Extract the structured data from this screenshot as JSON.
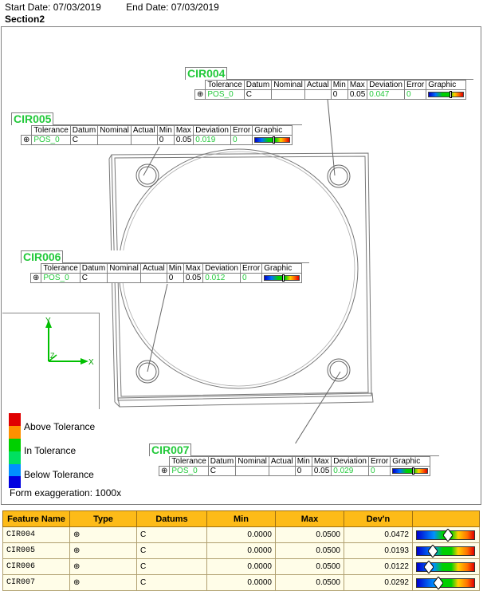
{
  "header": {
    "start_date_label": "Start Date: 07/03/2019",
    "end_date_label": "End Date: 07/03/2019",
    "section_title": "Section2"
  },
  "callout_headers": [
    "Tolerance",
    "Datum",
    "Nominal",
    "Actual",
    "Min",
    "Max",
    "Deviation",
    "Error",
    "Graphic"
  ],
  "callouts": [
    {
      "name": "CIR004",
      "tolerance": "POS_0",
      "datum": "C",
      "nominal": "",
      "actual": "",
      "min": "0",
      "max": "0.05",
      "deviation": "0.047",
      "error": "0",
      "graphic_fraction": 0.47
    },
    {
      "name": "CIR005",
      "tolerance": "POS_0",
      "datum": "C",
      "nominal": "",
      "actual": "",
      "min": "0",
      "max": "0.05",
      "deviation": "0.019",
      "error": "0",
      "graphic_fraction": 0.19
    },
    {
      "name": "CIR006",
      "tolerance": "POS_0",
      "datum": "C",
      "nominal": "",
      "actual": "",
      "min": "0",
      "max": "0.05",
      "deviation": "0.012",
      "error": "0",
      "graphic_fraction": 0.12
    },
    {
      "name": "CIR007",
      "tolerance": "POS_0",
      "datum": "C",
      "nominal": "",
      "actual": "",
      "min": "0",
      "max": "0.05",
      "deviation": "0.029",
      "error": "0",
      "graphic_fraction": 0.29
    }
  ],
  "axis_labels": {
    "y": "Y",
    "z": "Z",
    "x": "X"
  },
  "legend": {
    "above": "Above Tolerance",
    "in": "In Tolerance",
    "below": "Below Tolerance",
    "exaggeration": "Form exaggeration: 1000x"
  },
  "colors": {
    "above_1": "#e00000",
    "above_2": "#ff9000",
    "in_1": "#00d000",
    "in_2": "#00d000",
    "below_1": "#0090ff",
    "below_2": "#0000e0",
    "label_green": "#22c93a",
    "table_header": "#fdbb18"
  },
  "results_table": {
    "headers": [
      "Feature Name",
      "Type",
      "Datums",
      "Min",
      "Max",
      "Dev'n",
      ""
    ],
    "rows": [
      {
        "feature": "CIR004",
        "type_icon": "position-icon",
        "datums": "C",
        "min": "0.0000",
        "max": "0.0500",
        "dev": "0.0472",
        "dev_fraction": 0.472
      },
      {
        "feature": "CIR005",
        "type_icon": "position-icon",
        "datums": "C",
        "min": "0.0000",
        "max": "0.0500",
        "dev": "0.0193",
        "dev_fraction": 0.193
      },
      {
        "feature": "CIR006",
        "type_icon": "position-icon",
        "datums": "C",
        "min": "0.0000",
        "max": "0.0500",
        "dev": "0.0122",
        "dev_fraction": 0.122
      },
      {
        "feature": "CIR007",
        "type_icon": "position-icon",
        "datums": "C",
        "min": "0.0000",
        "max": "0.0500",
        "dev": "0.0292",
        "dev_fraction": 0.292
      }
    ]
  }
}
